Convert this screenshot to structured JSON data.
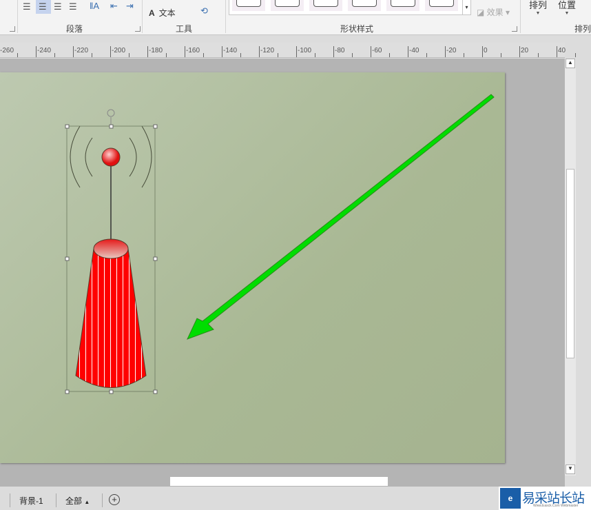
{
  "ribbon": {
    "paragraph_group": "段落",
    "tools_group": "工具",
    "text_tool": "文本",
    "shape_styles_group": "形状样式",
    "effects_label": "效果",
    "arrange_label": "排列",
    "position_label": "位置",
    "arrange_group": "排列"
  },
  "ruler": {
    "labels": [
      "-260",
      "-240",
      "-220",
      "-200",
      "-180",
      "-160",
      "-140",
      "-120",
      "-100",
      "-80",
      "-60",
      "-40",
      "-20",
      "0",
      "20",
      "40"
    ]
  },
  "status": {
    "page_tab": "背景-1",
    "all_pages": "全部",
    "add_page": "+"
  },
  "watermark": {
    "text": "易采站长站",
    "sub": "Www.Easck.Com Webmaster"
  },
  "colors": {
    "page": "#aab896",
    "arrow": "#00dd00",
    "antenna": "#ff0000"
  }
}
